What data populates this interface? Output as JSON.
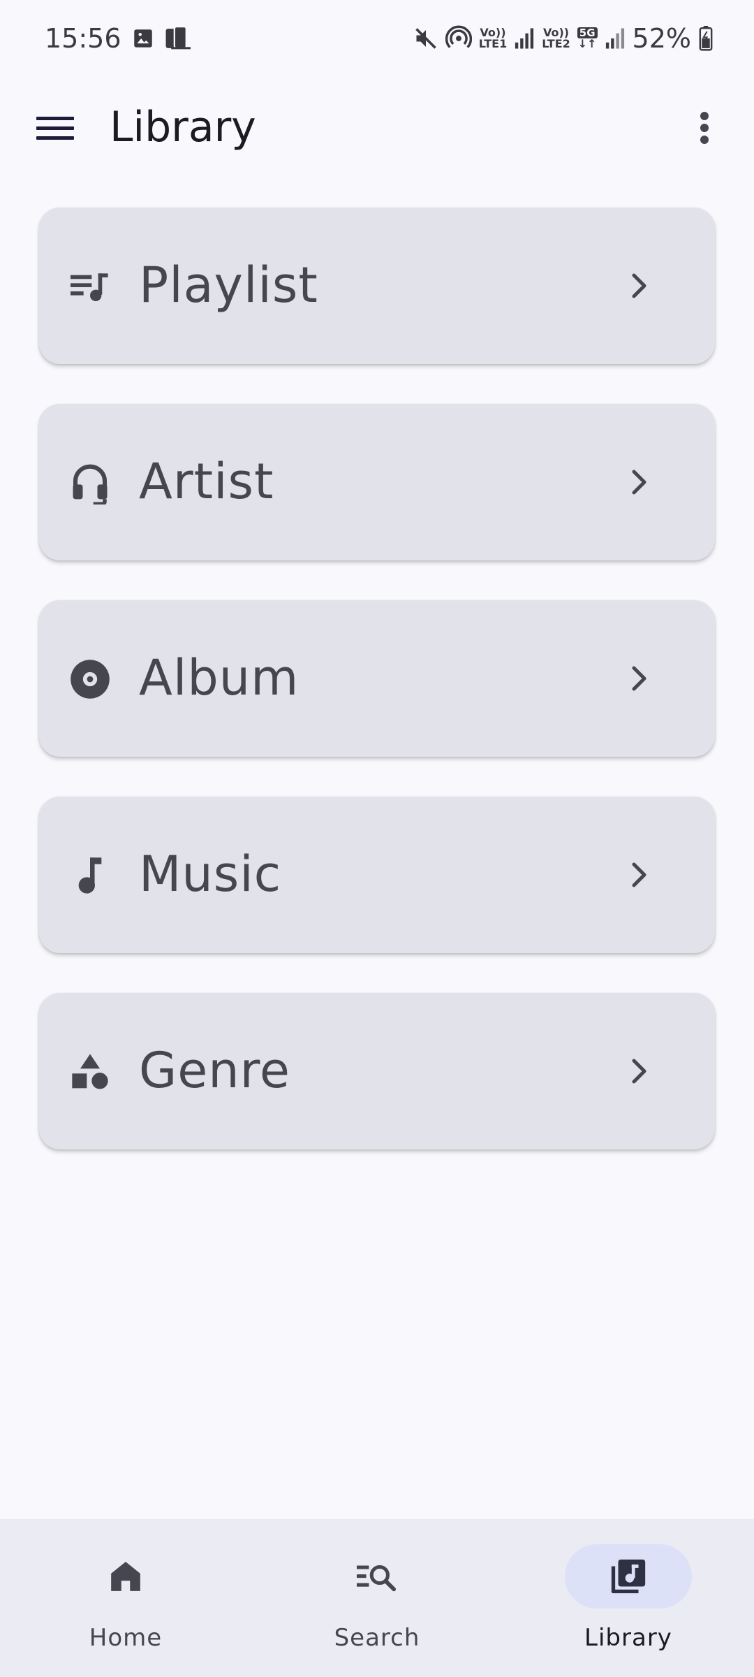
{
  "status_bar": {
    "time": "15:56",
    "battery": "52%",
    "sim1": [
      "Vo))",
      "LTE1"
    ],
    "sim2": [
      "Vo))",
      "LTE2"
    ],
    "network": "5G",
    "icons": [
      "image-icon",
      "phone-link-icon",
      "mute-icon",
      "hotspot-icon",
      "signal-icon",
      "battery-icon"
    ]
  },
  "app_bar": {
    "title": "Library",
    "left_icon": "menu-icon",
    "right_icon": "more-vert-icon"
  },
  "library_items": [
    {
      "label": "Playlist",
      "icon": "playlist-icon"
    },
    {
      "label": "Artist",
      "icon": "headphones-icon"
    },
    {
      "label": "Album",
      "icon": "album-icon"
    },
    {
      "label": "Music",
      "icon": "music-note-icon"
    },
    {
      "label": "Genre",
      "icon": "category-icon"
    }
  ],
  "bottom_nav": {
    "items": [
      {
        "label": "Home",
        "icon": "home-icon",
        "active": false
      },
      {
        "label": "Search",
        "icon": "search-list-icon",
        "active": false
      },
      {
        "label": "Library",
        "icon": "library-music-icon",
        "active": true
      }
    ]
  },
  "colors": {
    "background": "#f9f9fd",
    "card": "#e2e2ea",
    "nav_bar": "#ebebf3",
    "active_indicator": "#dde1f8",
    "icon": "#45464f"
  }
}
